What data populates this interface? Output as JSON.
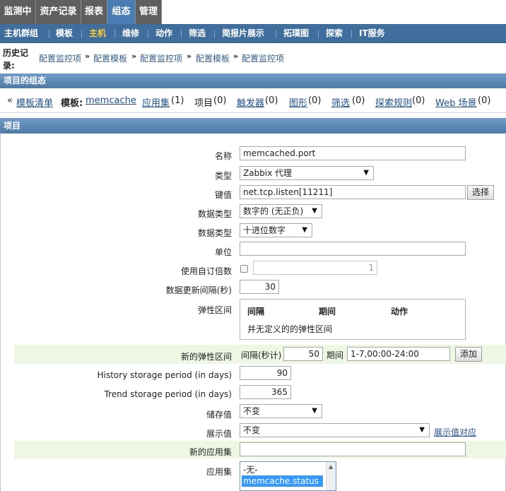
{
  "top_tabs": [
    {
      "label": "监测中"
    },
    {
      "label": "资产记录"
    },
    {
      "label": "报表"
    },
    {
      "label": "组态"
    },
    {
      "label": "管理"
    }
  ],
  "sub_menu": [
    {
      "label": "主机群组"
    },
    {
      "label": "模板"
    },
    {
      "label": "主机"
    },
    {
      "label": "维修"
    },
    {
      "label": "动作"
    },
    {
      "label": "筛选"
    },
    {
      "label": "简报片展示"
    },
    {
      "label": "拓璞图"
    },
    {
      "label": "探索"
    },
    {
      "label": "IT服务"
    }
  ],
  "history": {
    "label": "历史记录:",
    "crumbs": [
      "配置监控项",
      "配置模板",
      "配置监控项",
      "配置模板",
      "配置监控项"
    ],
    "separator": "»"
  },
  "section_title": "项目的组态",
  "template_nav": {
    "back_symbol": "«",
    "template_list": "模板清单",
    "template_label": "模板:",
    "template_name": "memcache",
    "apps": "应用集",
    "apps_count": "(1)",
    "items": "项目",
    "items_count": "(0)",
    "triggers": "触发器",
    "triggers_count": "(0)",
    "graphs": "图形",
    "graphs_count": "(0)",
    "screens": "筛选",
    "screens_count": "(0)",
    "discovery": "探索规则",
    "discovery_count": "(0)",
    "web": "Web 场景",
    "web_count": "(0)"
  },
  "form_title": "项目",
  "form": {
    "name_label": "名称",
    "name_value": "memcached.port",
    "type_label": "类型",
    "type_value": "Zabbix 代理",
    "key_label": "键值",
    "key_value": "net.tcp.listen[11211]",
    "select_button": "选择",
    "info_type_label": "数据类型",
    "info_type_value": "数字的 (无正负)",
    "data_type_label": "数据类型",
    "data_type_value": "十进位数字",
    "units_label": "单位",
    "units_value": "",
    "multiplier_label": "使用自订倍数",
    "multiplier_value": "1",
    "interval_label": "数据更新间隔(秒)",
    "interval_value": "30",
    "flex_label": "弹性区间",
    "flex_headers": [
      "间隔",
      "期间",
      "动作"
    ],
    "flex_empty": "并无定义的的弹性区间",
    "new_flex_label": "新的弹性区间",
    "new_flex_interval_label": "间隔(秒计)",
    "new_flex_interval_value": "50",
    "new_flex_period_label": "期间",
    "new_flex_period_value": "1-7,00:00-24:00",
    "add_button": "添加",
    "history_label": "History storage period (in days)",
    "history_value": "90",
    "trend_label": "Trend storage period (in days)",
    "trend_value": "365",
    "store_label": "储存值",
    "store_value": "不变",
    "show_label": "展示值",
    "show_value": "不变",
    "show_mapping_link": "展示值对应",
    "new_app_label": "新的应用集",
    "new_app_value": "",
    "apps_label": "应用集",
    "apps_options": [
      "-无-",
      "memcache.status"
    ]
  },
  "colors": {
    "top_tab_bg": "#5f5f5f",
    "top_tab_active": "#4a7db4",
    "submenu_bg": "#3f6e9d",
    "submenu_active": "#ffcc33",
    "section_bar": "#5a87b4",
    "highlight_row": "#eef7e4",
    "link": "#1f4f8a"
  }
}
